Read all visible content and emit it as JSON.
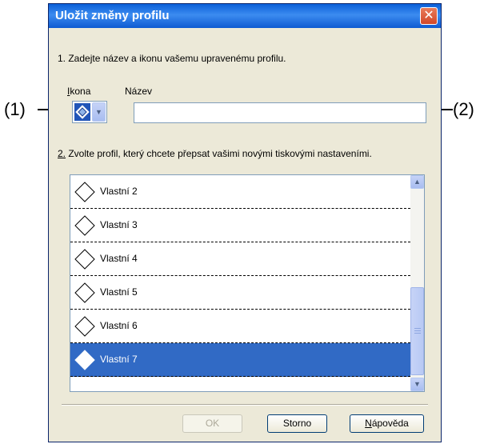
{
  "dialog": {
    "title": "Uložit změny profilu",
    "close_glyph": "✕",
    "step1_text": "1. Zadejte název a ikonu vašemu upravenému profilu.",
    "icon_label": "Ikona",
    "name_label": "Název",
    "name_value": "",
    "step2_text": "2. Zvolte profil, který chcete přepsat vašimi novými tiskovými nastaveními.",
    "profiles": [
      {
        "label": "Vlastní 2",
        "selected": false
      },
      {
        "label": "Vlastní 3",
        "selected": false
      },
      {
        "label": "Vlastní 4",
        "selected": false
      },
      {
        "label": "Vlastní 5",
        "selected": false
      },
      {
        "label": "Vlastní 6",
        "selected": false
      },
      {
        "label": "Vlastní 7",
        "selected": true
      }
    ],
    "buttons": {
      "ok": "OK",
      "cancel": "Storno",
      "help": "Nápověda"
    }
  },
  "callouts": {
    "icon": "(1)",
    "name": "(2)"
  },
  "colors": {
    "title_bar": "#0a5fd8",
    "dialog_bg": "#ece9d8",
    "selection": "#316ac5",
    "close_button": "#d2482a"
  },
  "icons": {
    "profile_item": "diamond-icon",
    "selected_icon": "document-diamond-icon",
    "dropdown": "chevron-down-icon",
    "scroll_up": "chevron-up-icon",
    "scroll_down": "chevron-down-icon",
    "close": "close-icon"
  }
}
